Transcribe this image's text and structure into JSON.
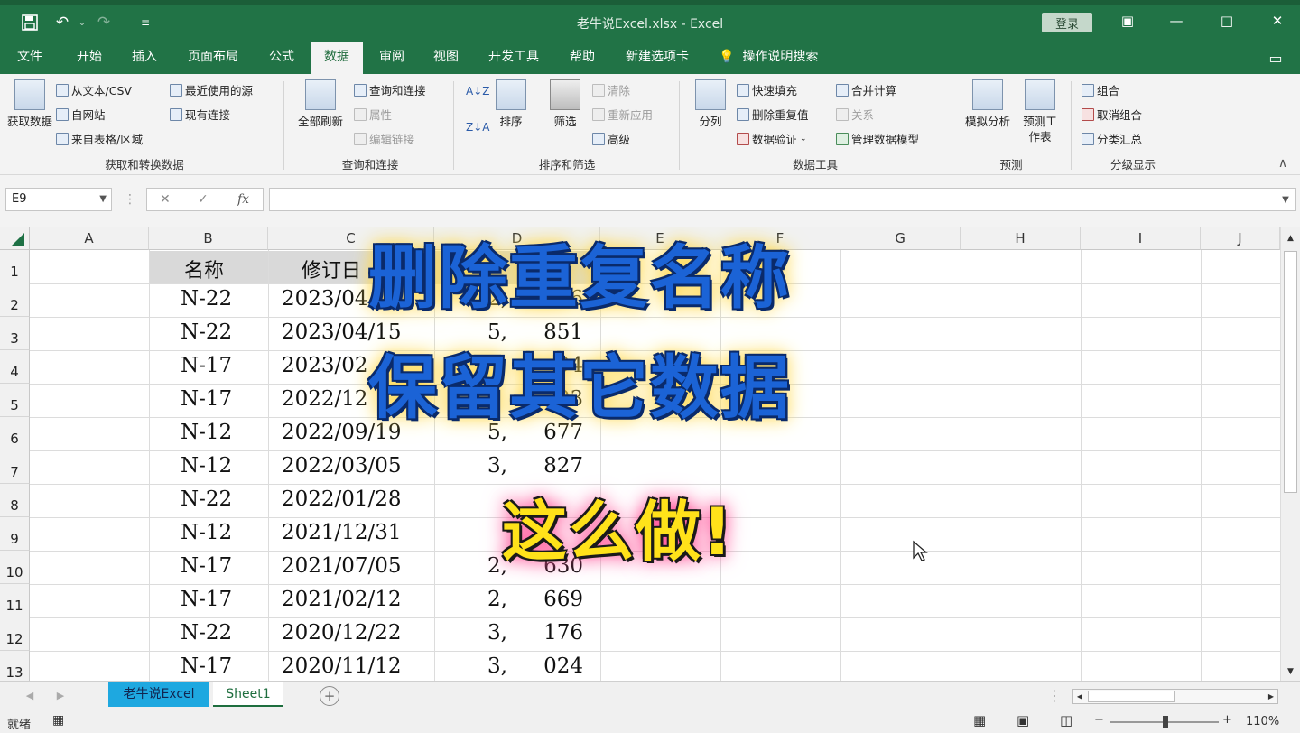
{
  "window": {
    "title": "老牛说Excel.xlsx  -  Excel",
    "login_label": "登录",
    "qa_icons": [
      "save-icon",
      "undo-icon",
      "redo-icon",
      "customize-icon"
    ],
    "controls": {
      "options": "▣",
      "minimize": "—",
      "maximize": "□",
      "close": "✕"
    }
  },
  "menu": {
    "tabs": [
      "文件",
      "开始",
      "插入",
      "页面布局",
      "公式",
      "数据",
      "审阅",
      "视图",
      "开发工具",
      "帮助",
      "新建选项卡"
    ],
    "active": "数据",
    "tell_me": "操作说明搜索"
  },
  "ribbon": {
    "get_data": {
      "label": "获取数据",
      "items": [
        "从文本/CSV",
        "自网站",
        "来自表格/区域",
        "最近使用的源",
        "现有连接"
      ],
      "group": "获取和转换数据"
    },
    "queries": {
      "refresh_all": "全部刷新",
      "items": [
        "查询和连接",
        "属性",
        "编辑链接"
      ],
      "group": "查询和连接"
    },
    "sort_filter": {
      "sort": "排序",
      "filter": "筛选",
      "items": [
        "清除",
        "重新应用",
        "高级"
      ],
      "group": "排序和筛选"
    },
    "data_tools": {
      "split": "分列",
      "items": [
        "快速填充",
        "删除重复值",
        "数据验证",
        "合并计算",
        "关系",
        "管理数据模型"
      ],
      "group": "数据工具"
    },
    "forecast": {
      "whatif": "模拟分析",
      "sheet": "预测工作表",
      "group": "预测"
    },
    "outline": {
      "items": [
        "组合",
        "取消组合",
        "分类汇总"
      ],
      "group": "分级显示"
    }
  },
  "formula_bar": {
    "name_box": "E9",
    "fx": "fx",
    "formula": ""
  },
  "grid": {
    "columns": [
      "A",
      "B",
      "C",
      "D",
      "E",
      "F",
      "G",
      "H",
      "I",
      "J"
    ],
    "rows": [
      "1",
      "2",
      "3",
      "4",
      "5",
      "6",
      "7",
      "8",
      "9",
      "10",
      "11",
      "12",
      "13"
    ],
    "header": [
      "名称",
      "修订日"
    ],
    "data": [
      [
        "N-22",
        "2023/04/",
        "",
        "2,",
        "816"
      ],
      [
        "N-22",
        "2023/04/15",
        "",
        "5,",
        "851"
      ],
      [
        "N-17",
        "2023/02",
        "",
        "",
        "94"
      ],
      [
        "N-17",
        "2022/12",
        "",
        "",
        "93"
      ],
      [
        "N-12",
        "2022/09/19",
        "",
        "5,",
        "677"
      ],
      [
        "N-12",
        "2022/03/05",
        "",
        "3,",
        "827"
      ],
      [
        "N-22",
        "2022/01/28",
        "",
        "",
        ""
      ],
      [
        "N-12",
        "2021/12/31",
        "",
        "",
        ""
      ],
      [
        "N-17",
        "2021/07/05",
        "",
        "2,",
        "630"
      ],
      [
        "N-17",
        "2021/02/12",
        "",
        "2,",
        "669"
      ],
      [
        "N-22",
        "2020/12/22",
        "",
        "3,",
        "176"
      ],
      [
        "N-17",
        "2020/11/12",
        "",
        "3,",
        "024"
      ]
    ]
  },
  "overlay": {
    "line1": "删除重复名称",
    "line2": "保留其它数据",
    "line3": "这么做!"
  },
  "sheets": {
    "tabs": [
      "老牛说Excel",
      "Sheet1"
    ],
    "active": "老牛说Excel",
    "add": "+"
  },
  "status": {
    "ready": "就绪",
    "zoom": "110%"
  }
}
